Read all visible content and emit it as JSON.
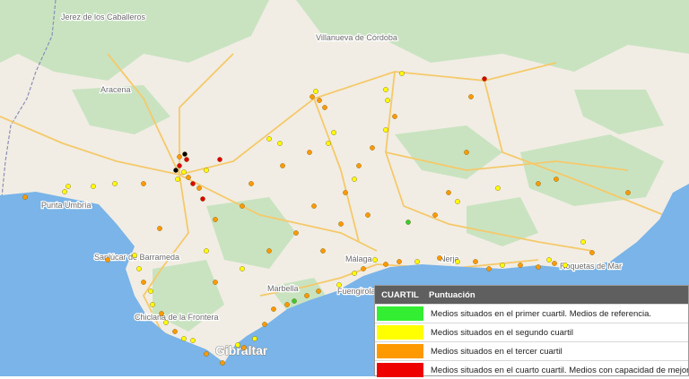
{
  "map": {
    "places": [
      {
        "id": "jerez-caballeros",
        "text": "Jerez de los Caballeros"
      },
      {
        "id": "villanueva",
        "text": "Villanueva de Córdoba"
      },
      {
        "id": "aracena",
        "text": "Aracena"
      },
      {
        "id": "punta-umbria",
        "text": "Punta Umbría"
      },
      {
        "id": "sanlucar",
        "text": "Sanlúcar de Barrameda"
      },
      {
        "id": "chiclana",
        "text": "Chiclana de la Frontera"
      },
      {
        "id": "marbella",
        "text": "Marbella"
      },
      {
        "id": "fuengirola",
        "text": "Fuengirola"
      },
      {
        "id": "malaga",
        "text": "Málaga"
      },
      {
        "id": "nerja",
        "text": "Nerja"
      },
      {
        "id": "roquetas",
        "text": "Roquetas de Mar"
      },
      {
        "id": "gibraltar",
        "text": "Gibraltar"
      }
    ],
    "colors": {
      "land": "#f1ede4",
      "green": "#c9e3c1",
      "water": "#7ab4e8",
      "road": "#f5c96a",
      "q1": "#33cc33",
      "q2": "#ffff00",
      "q3": "#ff9900",
      "q4": "#dd0000"
    }
  },
  "legend": {
    "header_col1": "CUARTIL",
    "header_col2": "Puntuación",
    "rows": [
      {
        "color": "#33ee33",
        "text": "Medios situados en el primer cuartil. Medios de referencia."
      },
      {
        "color": "#ffff00",
        "text": "Medios situados en el segundo cuartil"
      },
      {
        "color": "#ff9900",
        "text": "Medios situados en el tercer cuartil"
      },
      {
        "color": "#ee0000",
        "text": "Medios situados en el cuarto cuartil. Medios con capacidad de mejora"
      }
    ]
  }
}
